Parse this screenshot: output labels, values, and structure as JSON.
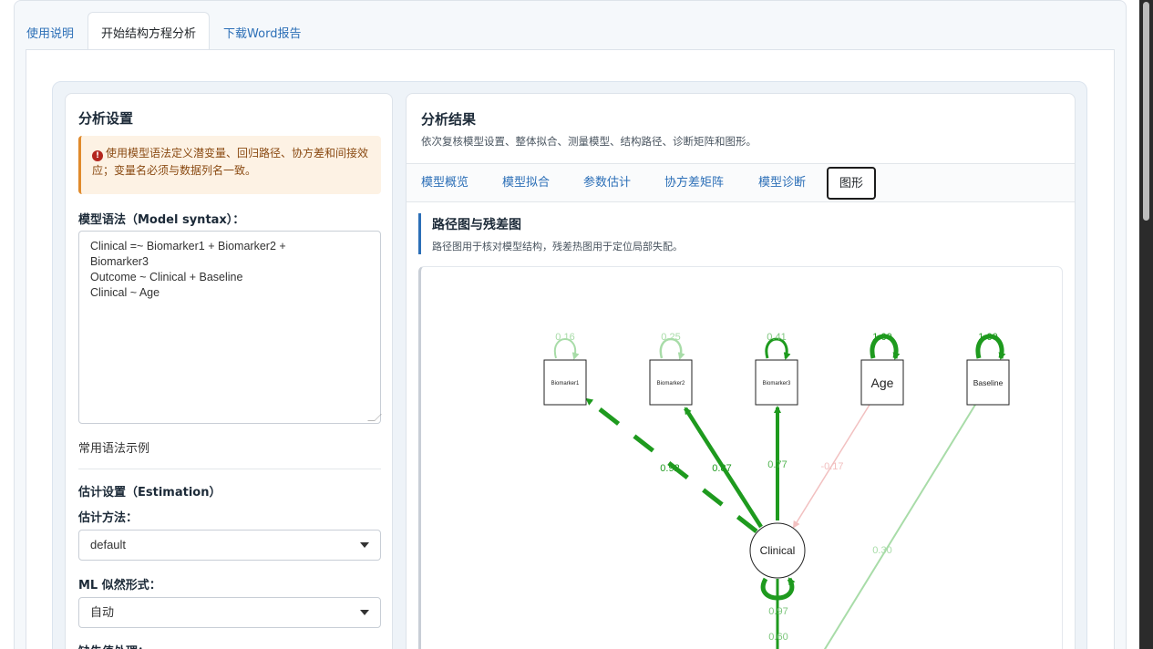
{
  "nav": {
    "tabs": [
      {
        "label": "使用说明"
      },
      {
        "label": "开始结构方程分析"
      },
      {
        "label": "下载Word报告"
      }
    ]
  },
  "settings": {
    "title": "分析设置",
    "alert": "使用模型语法定义潜变量、回归路径、协方差和间接效应；变量名必须与数据列名一致。",
    "syntax_label": "模型语法（Model syntax）：",
    "syntax_value": "Clinical =~ Biomarker1 + Biomarker2 +\nBiomarker3\nOutcome ~ Clinical + Baseline\nClinical ~ Age",
    "examples_label": "常用语法示例",
    "estimation_heading": "估计设置（Estimation）",
    "method_label": "估计方法：",
    "method_value": "default",
    "likelihood_label": "ML 似然形式：",
    "likelihood_value": "自动",
    "missing_label": "缺失值处理："
  },
  "results": {
    "title": "分析结果",
    "subtitle": "依次复核模型设置、整体拟合、测量模型、结构路径、诊断矩阵和图形。",
    "tabs": [
      "模型概览",
      "模型拟合",
      "参数估计",
      "协方差矩阵",
      "模型诊断",
      "图形"
    ],
    "section_title": "路径图与残差图",
    "section_subtitle": "路径图用于核对模型结构，残差热图用于定位局部失配。"
  },
  "diagram": {
    "nodes": [
      {
        "id": "b1",
        "label": "Biomarker1",
        "variance": "0.16"
      },
      {
        "id": "b2",
        "label": "Biomarker2",
        "variance": "0.25"
      },
      {
        "id": "b3",
        "label": "Biomarker3",
        "variance": "0.41"
      },
      {
        "id": "age",
        "label": "Age",
        "variance": "1.00"
      },
      {
        "id": "base",
        "label": "Baseline",
        "variance": "1.00"
      },
      {
        "id": "clin",
        "label": "Clinical",
        "variance": "0.97"
      }
    ],
    "edges": [
      {
        "id": "b1",
        "label": "0.92"
      },
      {
        "id": "b2",
        "label": "0.87"
      },
      {
        "id": "b3",
        "label": "0.77"
      },
      {
        "id": "age",
        "label": "-0.17"
      },
      {
        "id": "base",
        "label": "0.30"
      },
      {
        "id": "out",
        "label": "0.60"
      }
    ],
    "colors": {
      "strong": "#1e9a1e",
      "light": "#a8dca8",
      "negative": "#f2c0c0",
      "node_border": "#222222"
    }
  }
}
